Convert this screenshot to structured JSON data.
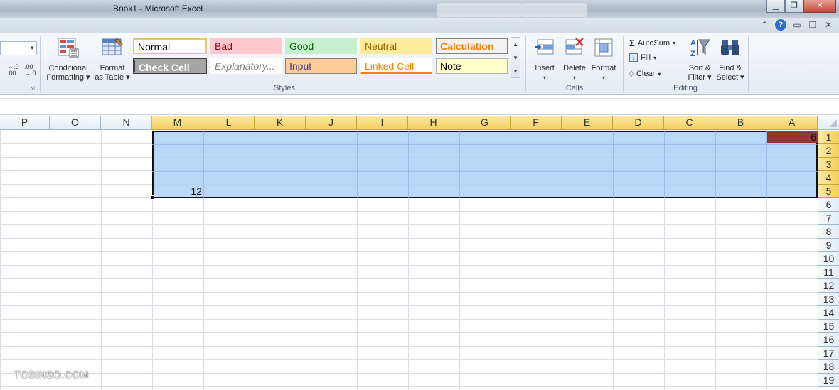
{
  "window": {
    "title": "Book1  -  Microsoft Excel",
    "minimize_icon": "minimize-icon",
    "restore_icon": "restore-icon",
    "close_icon": "close-icon"
  },
  "helper_icons": [
    "chevron-up-icon",
    "help-icon",
    "minimize-icon",
    "restore-icon",
    "close-icon"
  ],
  "help_glyph": "?",
  "ribbon": {
    "number": {
      "increase_decimal": ".0\n.00",
      "decrease_decimal": ".00\n→.0"
    },
    "conditional_formatting": "Conditional\nFormatting ▾",
    "format_as_table": "Format\nas Table ▾",
    "styles_group_label": "Styles",
    "styles": [
      {
        "label": "Normal",
        "bg": "#ffffff",
        "color": "#000000",
        "border": "#e8c56b"
      },
      {
        "label": "Bad",
        "bg": "#ffc7ce",
        "color": "#9c0006",
        "border": "#ffc7ce"
      },
      {
        "label": "Good",
        "bg": "#c6efce",
        "color": "#006100",
        "border": "#c6efce"
      },
      {
        "label": "Neutral",
        "bg": "#ffeb9c",
        "color": "#9c6500",
        "border": "#ffeb9c"
      },
      {
        "label": "Calculation",
        "bg": "#f2f2f2",
        "color": "#fa7d00",
        "border": "#7f7f7f"
      },
      {
        "label": "Check Cell",
        "bg": "#a5a5a5",
        "color": "#ffffff",
        "border": "#3f3f3f"
      },
      {
        "label": "Explanatory...",
        "bg": "#ffffff",
        "color": "#7f7f7f",
        "border": "#ffffff"
      },
      {
        "label": "Input",
        "bg": "#ffcc99",
        "color": "#3f3f76",
        "border": "#7f7f7f"
      },
      {
        "label": "Linked Cell",
        "bg": "#ffffff",
        "color": "#fa7d00",
        "border": "#ffffff"
      },
      {
        "label": "Note",
        "bg": "#ffffcc",
        "color": "#000000",
        "border": "#b2b2b2"
      }
    ],
    "cells_group_label": "Cells",
    "insert": "Insert",
    "delete": "Delete",
    "format": "Format",
    "editing_group_label": "Editing",
    "autosum": "AutoSum",
    "fill": "Fill",
    "clear": "Clear",
    "sort_filter": "Sort &\nFilter ▾",
    "find_select": "Find &\nSelect ▾"
  },
  "grid": {
    "columns": [
      "A",
      "B",
      "C",
      "D",
      "E",
      "F",
      "G",
      "H",
      "I",
      "J",
      "K",
      "L",
      "M",
      "N",
      "O",
      "P"
    ],
    "selected_columns": [
      "A",
      "B",
      "C",
      "D",
      "E",
      "F",
      "G",
      "H",
      "I",
      "J",
      "K",
      "L",
      "M"
    ],
    "rows": [
      "1",
      "2",
      "3",
      "4",
      "5",
      "6",
      "7",
      "8",
      "9",
      "10",
      "11",
      "12",
      "13",
      "14",
      "15",
      "16",
      "17",
      "18",
      "19"
    ],
    "selected_rows": [
      "1",
      "2",
      "3",
      "4",
      "5"
    ],
    "cells": {
      "A1": "6",
      "M5": "12"
    },
    "a1_fill": "#943634",
    "selection_fill": "#add0f5"
  },
  "watermark": "TOSINSO.COM"
}
